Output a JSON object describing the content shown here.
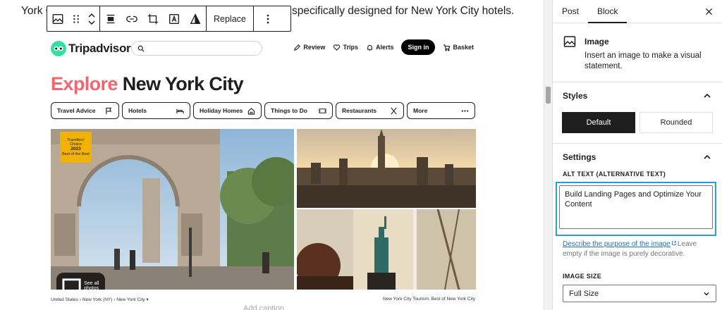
{
  "editor": {
    "para_left": "York C",
    "para_right": "specifically designed for New York City hotels.",
    "caption_placeholder": "Add caption"
  },
  "toolbar": {
    "replace_label": "Replace"
  },
  "tripadvisor": {
    "logo_text": "Tripadvisor",
    "nav": [
      "Review",
      "Trips",
      "Alerts"
    ],
    "signin": "Sign in",
    "basket": "Basket",
    "title_accent": "Explore",
    "title_rest": "New York City",
    "pills": [
      "Travel Advice",
      "Hotels",
      "Holiday Homes",
      "Things to Do",
      "Restaurants",
      "More"
    ],
    "badge_line1": "Travellers'",
    "badge_line2": "Choice",
    "badge_year": "2023",
    "badge_line3": "Best of the Best",
    "see_all": "See all photos",
    "breadcrumb": "United States › New York (NY) › New York City ▾",
    "footer_right": "New York City Tourism: Best of New York City"
  },
  "sidebar": {
    "tab_post": "Post",
    "tab_block": "Block",
    "block_title": "Image",
    "block_desc": "Insert an image to make a visual statement.",
    "styles_title": "Styles",
    "style_default": "Default",
    "style_rounded": "Rounded",
    "settings_title": "Settings",
    "alt_label": "ALT TEXT (ALTERNATIVE TEXT)",
    "alt_value": "Build Landing Pages and Optimize Your Content",
    "alt_link": "Describe the purpose of the image",
    "alt_help_rest": "Leave empty if the image is purely decorative.",
    "size_label": "IMAGE SIZE",
    "size_value": "Full Size"
  },
  "colors": {
    "accent": "#f2666e",
    "focus": "#2a9cd8",
    "link": "#2271b1",
    "ta_green": "#34e0a1",
    "badge": "#f2b203"
  }
}
